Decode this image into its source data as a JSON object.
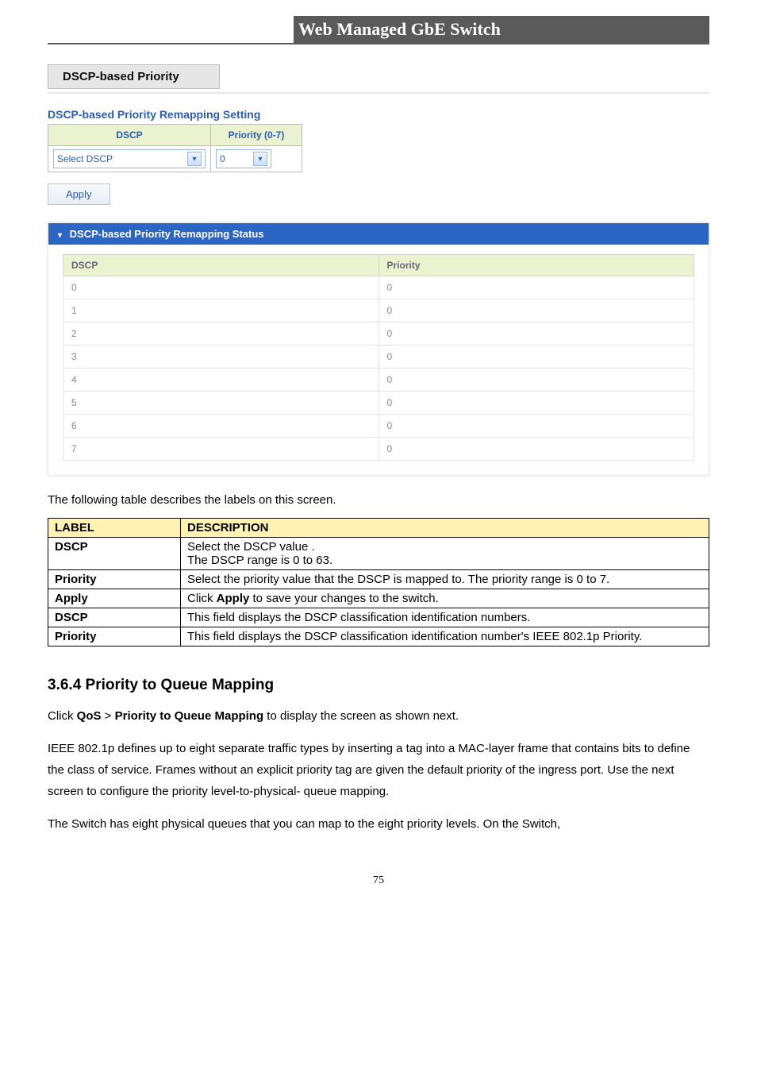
{
  "banner": {
    "title": "Web Managed GbE Switch"
  },
  "dscpTab": {
    "label": "DSCP-based Priority"
  },
  "setting": {
    "title": "DSCP-based Priority Remapping Setting",
    "colDscp": "DSCP",
    "colPriority": "Priority (0-7)",
    "dscpSelectText": "Select DSCP",
    "prioritySelectText": "0",
    "applyLabel": "Apply"
  },
  "status": {
    "title": "DSCP-based Priority Remapping Status",
    "colDscp": "DSCP",
    "colPriority": "Priority",
    "rows": [
      {
        "dscp": "0",
        "priority": "0"
      },
      {
        "dscp": "1",
        "priority": "0"
      },
      {
        "dscp": "2",
        "priority": "0"
      },
      {
        "dscp": "3",
        "priority": "0"
      },
      {
        "dscp": "4",
        "priority": "0"
      },
      {
        "dscp": "5",
        "priority": "0"
      },
      {
        "dscp": "6",
        "priority": "0"
      },
      {
        "dscp": "7",
        "priority": "0"
      }
    ]
  },
  "descIntro": "The following table describes the labels on this screen.",
  "descTable": {
    "hLabel": "LABEL",
    "hDesc": "DESCRIPTION",
    "rows": [
      {
        "label": "DSCP",
        "desc": "Select the DSCP value                                                                  .\nThe DSCP range is 0 to 63."
      },
      {
        "label": "Priority",
        "desc": "Select the priority value that the DSCP is mapped to. The priority range is 0 to 7."
      },
      {
        "label": "Apply",
        "desc": "Click Apply to save your changes to the switch."
      },
      {
        "label": "DSCP",
        "desc": "This field displays the DSCP classification identification numbers."
      },
      {
        "label": "Priority",
        "desc": "This field displays the DSCP classification identification number's IEEE 802.1p Priority."
      }
    ]
  },
  "section": {
    "heading": "3.6.4 Priority to Queue Mapping",
    "line1_a": "Click ",
    "line1_b": "QoS",
    "line1_c": " > ",
    "line1_d": "Priority to Queue Mapping",
    "line1_e": " to display the screen as shown next.",
    "para2": "IEEE 802.1p defines up to eight separate traffic types by inserting a tag into a MAC-layer frame that contains bits to define the class of service. Frames without an explicit priority tag are given the default priority of the ingress port. Use the next screen to configure the priority level-to-physical- queue mapping.",
    "para3": "The Switch has eight physical queues that you can map to the eight priority levels. On the Switch,"
  },
  "pageNumber": "75",
  "chart_data": {
    "type": "table",
    "title": "DSCP-based Priority Remapping Status",
    "columns": [
      "DSCP",
      "Priority"
    ],
    "rows": [
      [
        "0",
        "0"
      ],
      [
        "1",
        "0"
      ],
      [
        "2",
        "0"
      ],
      [
        "3",
        "0"
      ],
      [
        "4",
        "0"
      ],
      [
        "5",
        "0"
      ],
      [
        "6",
        "0"
      ],
      [
        "7",
        "0"
      ]
    ]
  }
}
